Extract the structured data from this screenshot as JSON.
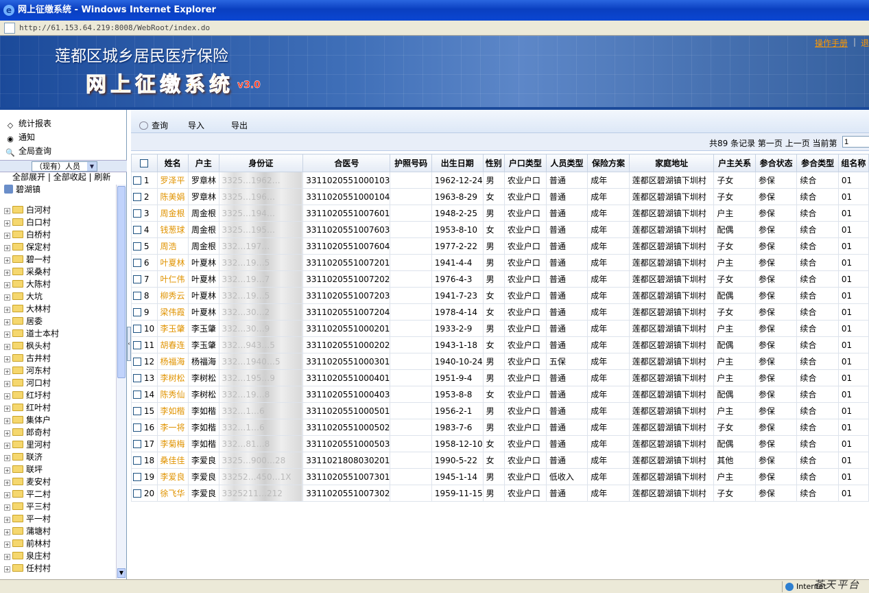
{
  "window": {
    "title": "网上征缴系统 - Windows Internet Explorer",
    "url": "http://61.153.64.219:8008/WebRoot/index.do",
    "status_zone": "Internet",
    "watermark": "苍天平台"
  },
  "banner": {
    "title1": "莲都区城乡居民医疗保险",
    "title2": "网上征缴系统",
    "version": "v3.0",
    "manual": "操作手册",
    "logout": "退"
  },
  "left": {
    "nav": [
      "统计报表",
      "通知",
      "全局查询"
    ],
    "select": "（现有）人员",
    "actions": [
      "全部展开",
      "全部收起",
      "刷新"
    ],
    "root": "碧湖镇",
    "villages": [
      "白河村",
      "白口村",
      "白桥村",
      "保定村",
      "碧一村",
      "采桑村",
      "大陈村",
      "大坑",
      "大林村",
      "居委",
      "道士本村",
      "枫头村",
      "古井村",
      "河东村",
      "河口村",
      "红圩村",
      "红叶村",
      "集体户",
      "郎奇村",
      "里河村",
      "联济",
      "联坪",
      "麦安村",
      "平二村",
      "平三村",
      "平一村",
      "蒲塘村",
      "前林村",
      "泉庄村",
      "任村村"
    ]
  },
  "toolbar": {
    "query": "查询",
    "import": "导入",
    "export": "导出"
  },
  "pager": {
    "text": "共89 条记录  第一页  上一页  当前第",
    "current": "1"
  },
  "table": {
    "headers": [
      "姓名",
      "户主",
      "身份证",
      "合医号",
      "护照号码",
      "出生日期",
      "性别",
      "户口类型",
      "人员类型",
      "保险方案",
      "家庭地址",
      "户主关系",
      "参合状态",
      "参合类型",
      "组名称"
    ],
    "rows": [
      {
        "no": "1",
        "name": "罗泽平",
        "head": "罗章林",
        "id": "3325…1962…",
        "med": "3311020551000103",
        "birth": "1962-12-24",
        "sex": "男",
        "hk": "农业户口",
        "type": "普通",
        "plan": "成年",
        "addr": "莲都区碧湖镇下圳村",
        "rel": "子女",
        "state": "参保",
        "ctype": "续合",
        "grp": "01"
      },
      {
        "no": "2",
        "name": "陈美娟",
        "head": "罗章林",
        "id": "3325…196…",
        "med": "3311020551000104",
        "birth": "1963-8-29",
        "sex": "女",
        "hk": "农业户口",
        "type": "普通",
        "plan": "成年",
        "addr": "莲都区碧湖镇下圳村",
        "rel": "子女",
        "state": "参保",
        "ctype": "续合",
        "grp": "01"
      },
      {
        "no": "3",
        "name": "周金根",
        "head": "周金根",
        "id": "3325…194…",
        "med": "3311020551007601",
        "birth": "1948-2-25",
        "sex": "男",
        "hk": "农业户口",
        "type": "普通",
        "plan": "成年",
        "addr": "莲都区碧湖镇下圳村",
        "rel": "户主",
        "state": "参保",
        "ctype": "续合",
        "grp": "01"
      },
      {
        "no": "4",
        "name": "钱葱球",
        "head": "周金根",
        "id": "3325…195…",
        "med": "3311020551007603",
        "birth": "1953-8-10",
        "sex": "女",
        "hk": "农业户口",
        "type": "普通",
        "plan": "成年",
        "addr": "莲都区碧湖镇下圳村",
        "rel": "配偶",
        "state": "参保",
        "ctype": "续合",
        "grp": "01"
      },
      {
        "no": "5",
        "name": "周浩",
        "head": "周金根",
        "id": "332…197…",
        "med": "3311020551007604",
        "birth": "1977-2-22",
        "sex": "男",
        "hk": "农业户口",
        "type": "普通",
        "plan": "成年",
        "addr": "莲都区碧湖镇下圳村",
        "rel": "子女",
        "state": "参保",
        "ctype": "续合",
        "grp": "01"
      },
      {
        "no": "6",
        "name": "叶夏林",
        "head": "叶夏林",
        "id": "332…19…5",
        "med": "3311020551007201",
        "birth": "1941-4-4",
        "sex": "男",
        "hk": "农业户口",
        "type": "普通",
        "plan": "成年",
        "addr": "莲都区碧湖镇下圳村",
        "rel": "户主",
        "state": "参保",
        "ctype": "续合",
        "grp": "01"
      },
      {
        "no": "7",
        "name": "叶仁伟",
        "head": "叶夏林",
        "id": "332…19…7",
        "med": "3311020551007202",
        "birth": "1976-4-3",
        "sex": "男",
        "hk": "农业户口",
        "type": "普通",
        "plan": "成年",
        "addr": "莲都区碧湖镇下圳村",
        "rel": "子女",
        "state": "参保",
        "ctype": "续合",
        "grp": "01"
      },
      {
        "no": "8",
        "name": "柳秀云",
        "head": "叶夏林",
        "id": "332…19…5",
        "med": "3311020551007203",
        "birth": "1941-7-23",
        "sex": "女",
        "hk": "农业户口",
        "type": "普通",
        "plan": "成年",
        "addr": "莲都区碧湖镇下圳村",
        "rel": "配偶",
        "state": "参保",
        "ctype": "续合",
        "grp": "01"
      },
      {
        "no": "9",
        "name": "梁伟霞",
        "head": "叶夏林",
        "id": "332…30…2",
        "med": "3311020551007204",
        "birth": "1978-4-14",
        "sex": "女",
        "hk": "农业户口",
        "type": "普通",
        "plan": "成年",
        "addr": "莲都区碧湖镇下圳村",
        "rel": "子女",
        "state": "参保",
        "ctype": "续合",
        "grp": "01"
      },
      {
        "no": "10",
        "name": "李玉肇",
        "head": "李玉肇",
        "id": "332…30…9",
        "med": "3311020551000201",
        "birth": "1933-2-9",
        "sex": "男",
        "hk": "农业户口",
        "type": "普通",
        "plan": "成年",
        "addr": "莲都区碧湖镇下圳村",
        "rel": "户主",
        "state": "参保",
        "ctype": "续合",
        "grp": "01"
      },
      {
        "no": "11",
        "name": "胡春连",
        "head": "李玉肇",
        "id": "332…943…5",
        "med": "3311020551000202",
        "birth": "1943-1-18",
        "sex": "女",
        "hk": "农业户口",
        "type": "普通",
        "plan": "成年",
        "addr": "莲都区碧湖镇下圳村",
        "rel": "配偶",
        "state": "参保",
        "ctype": "续合",
        "grp": "01"
      },
      {
        "no": "12",
        "name": "杨福海",
        "head": "杨福海",
        "id": "332…1940…5",
        "med": "3311020551000301",
        "birth": "1940-10-24",
        "sex": "男",
        "hk": "农业户口",
        "type": "五保",
        "plan": "成年",
        "addr": "莲都区碧湖镇下圳村",
        "rel": "户主",
        "state": "参保",
        "ctype": "续合",
        "grp": "01"
      },
      {
        "no": "13",
        "name": "李树松",
        "head": "李树松",
        "id": "332…195…9",
        "med": "3311020551000401",
        "birth": "1951-9-4",
        "sex": "男",
        "hk": "农业户口",
        "type": "普通",
        "plan": "成年",
        "addr": "莲都区碧湖镇下圳村",
        "rel": "户主",
        "state": "参保",
        "ctype": "续合",
        "grp": "01"
      },
      {
        "no": "14",
        "name": "陈秀仙",
        "head": "李树松",
        "id": "332…19…8",
        "med": "3311020551000403",
        "birth": "1953-8-8",
        "sex": "女",
        "hk": "农业户口",
        "type": "普通",
        "plan": "成年",
        "addr": "莲都区碧湖镇下圳村",
        "rel": "配偶",
        "state": "参保",
        "ctype": "续合",
        "grp": "01"
      },
      {
        "no": "15",
        "name": "李如楷",
        "head": "李如楷",
        "id": "332…1…6",
        "med": "3311020551000501",
        "birth": "1956-2-1",
        "sex": "男",
        "hk": "农业户口",
        "type": "普通",
        "plan": "成年",
        "addr": "莲都区碧湖镇下圳村",
        "rel": "户主",
        "state": "参保",
        "ctype": "续合",
        "grp": "01"
      },
      {
        "no": "16",
        "name": "李一将",
        "head": "李如楷",
        "id": "332…1…6",
        "med": "3311020551000502",
        "birth": "1983-7-6",
        "sex": "男",
        "hk": "农业户口",
        "type": "普通",
        "plan": "成年",
        "addr": "莲都区碧湖镇下圳村",
        "rel": "子女",
        "state": "参保",
        "ctype": "续合",
        "grp": "01"
      },
      {
        "no": "17",
        "name": "李菊梅",
        "head": "李如楷",
        "id": "332…81…8",
        "med": "3311020551000503",
        "birth": "1958-12-10",
        "sex": "女",
        "hk": "农业户口",
        "type": "普通",
        "plan": "成年",
        "addr": "莲都区碧湖镇下圳村",
        "rel": "配偶",
        "state": "参保",
        "ctype": "续合",
        "grp": "01"
      },
      {
        "no": "18",
        "name": "桑佳佳",
        "head": "李爱良",
        "id": "3325…900…28",
        "med": "3311021808030201",
        "birth": "1990-5-22",
        "sex": "女",
        "hk": "农业户口",
        "type": "普通",
        "plan": "成年",
        "addr": "莲都区碧湖镇下圳村",
        "rel": "其他",
        "state": "参保",
        "ctype": "续合",
        "grp": "01"
      },
      {
        "no": "19",
        "name": "李爱良",
        "head": "李爱良",
        "id": "33252…450…1X",
        "med": "3311020551007301",
        "birth": "1945-1-14",
        "sex": "男",
        "hk": "农业户口",
        "type": "低收入",
        "plan": "成年",
        "addr": "莲都区碧湖镇下圳村",
        "rel": "户主",
        "state": "参保",
        "ctype": "续合",
        "grp": "01"
      },
      {
        "no": "20",
        "name": "徐飞华",
        "head": "李爱良",
        "id": "3325211…212",
        "med": "3311020551007302",
        "birth": "1959-11-15",
        "sex": "男",
        "hk": "农业户口",
        "type": "普通",
        "plan": "成年",
        "addr": "莲都区碧湖镇下圳村",
        "rel": "子女",
        "state": "参保",
        "ctype": "续合",
        "grp": "01"
      }
    ]
  }
}
